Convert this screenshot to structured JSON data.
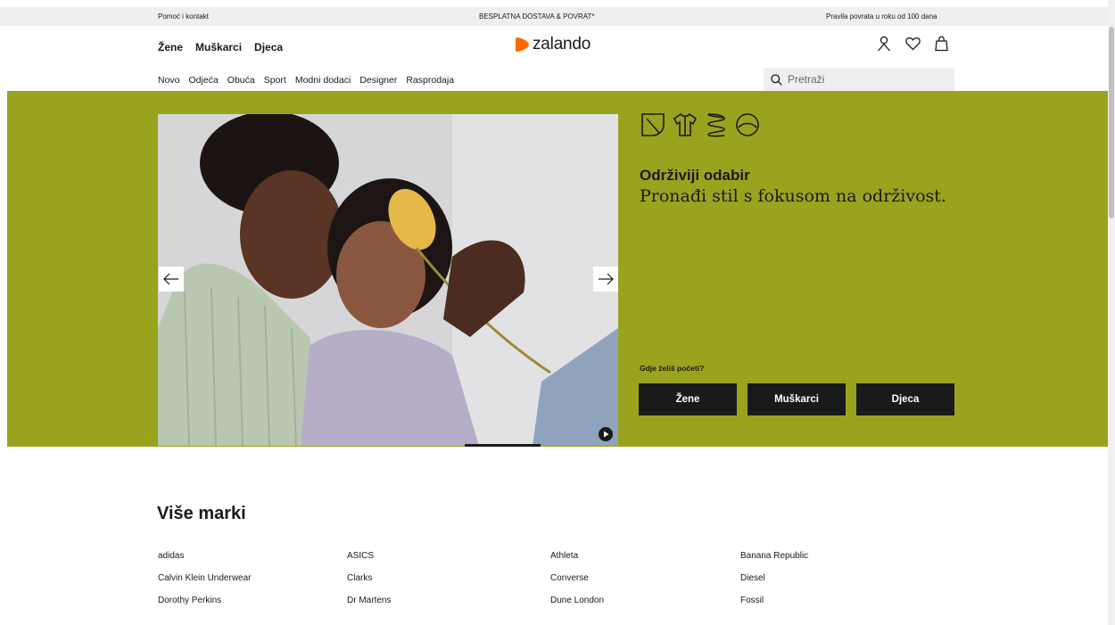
{
  "utility_bar": {
    "help": "Pomoć i kontakt",
    "shipping": "BESPLATNA DOSTAVA & POVRAT*",
    "returns": "Pravila povrata u roku od 100 dana"
  },
  "header": {
    "gender_nav": [
      "Žene",
      "Muškarci",
      "Djeca"
    ],
    "logo_text": "zalando",
    "brand_color": "#ff6900",
    "icons": [
      "user-icon",
      "heart-icon",
      "bag-icon"
    ]
  },
  "category_nav": [
    "Novo",
    "Odjeća",
    "Obuća",
    "Sport",
    "Modni dodaci",
    "Designer",
    "Rasprodaja"
  ],
  "search": {
    "placeholder": "Pretraži"
  },
  "hero": {
    "background": "#9aa31e",
    "title": "Održiviji odabir",
    "subtitle": "Pronađi stil s fokusom na održivost.",
    "prompt": "Gdje želiš početi?",
    "buttons": [
      "Žene",
      "Muškarci",
      "Djeca"
    ],
    "sustainability_icons": [
      "leaf-icon",
      "shirt-icon",
      "recycle-icon",
      "circle-icon"
    ]
  },
  "brands": {
    "title": "Više marki",
    "items": [
      "adidas",
      "ASICS",
      "Athleta",
      "Banana Republic",
      "Calvin Klein Underwear",
      "Clarks",
      "Converse",
      "Diesel",
      "Dorothy Perkins",
      "Dr Martens",
      "Dune London",
      "Fossil"
    ]
  }
}
